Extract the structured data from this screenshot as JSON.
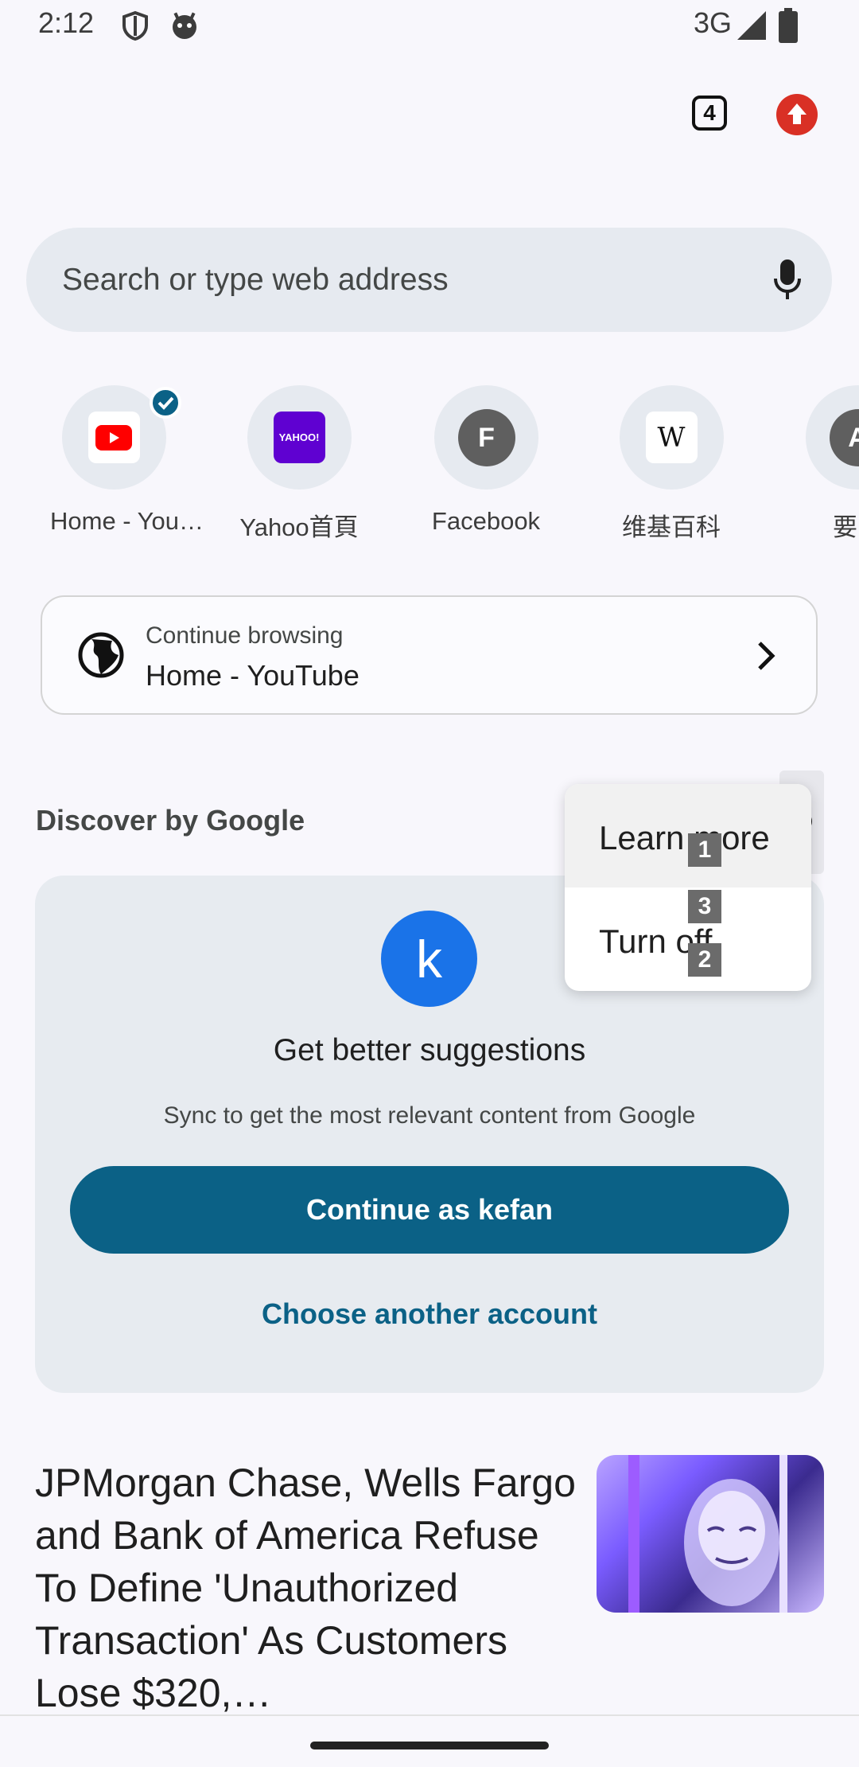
{
  "status_bar": {
    "time": "2:12",
    "network": "3G"
  },
  "toolbar": {
    "tab_count": "4"
  },
  "search": {
    "placeholder": "Search or type web address"
  },
  "shortcuts": [
    {
      "label": "Home - You…",
      "icon": "youtube-icon"
    },
    {
      "label": "Yahoo首頁",
      "icon": "yahoo-icon",
      "logo_text": "YAHOO!"
    },
    {
      "label": "Facebook",
      "icon": "letter-icon",
      "letter": "F"
    },
    {
      "label": "维基百科",
      "icon": "wikipedia-icon",
      "logo_text": "W"
    },
    {
      "label": "要聞",
      "icon": "letter-icon",
      "letter": "A"
    }
  ],
  "continue_browsing": {
    "heading": "Continue browsing",
    "title": "Home - YouTube"
  },
  "discover": {
    "title": "Discover by Google"
  },
  "menu": {
    "items": [
      {
        "label": "Learn more",
        "badge": "1"
      },
      {
        "label": "Turn off",
        "badge": "2"
      }
    ],
    "extra_badge": "3"
  },
  "promo": {
    "avatar_letter": "k",
    "title": "Get better suggestions",
    "subtitle": "Sync to get the most relevant content from Google",
    "primary_label": "Continue as kefan",
    "secondary_label": "Choose another account"
  },
  "article": {
    "title": "JPMorgan Chase, Wells Fargo and Bank of America Refuse To Define 'Unauthorized Transaction' As Customers Lose $320,…"
  },
  "colors": {
    "accent": "#0b6186",
    "avatar": "#1a73e8",
    "update": "#d93025"
  }
}
